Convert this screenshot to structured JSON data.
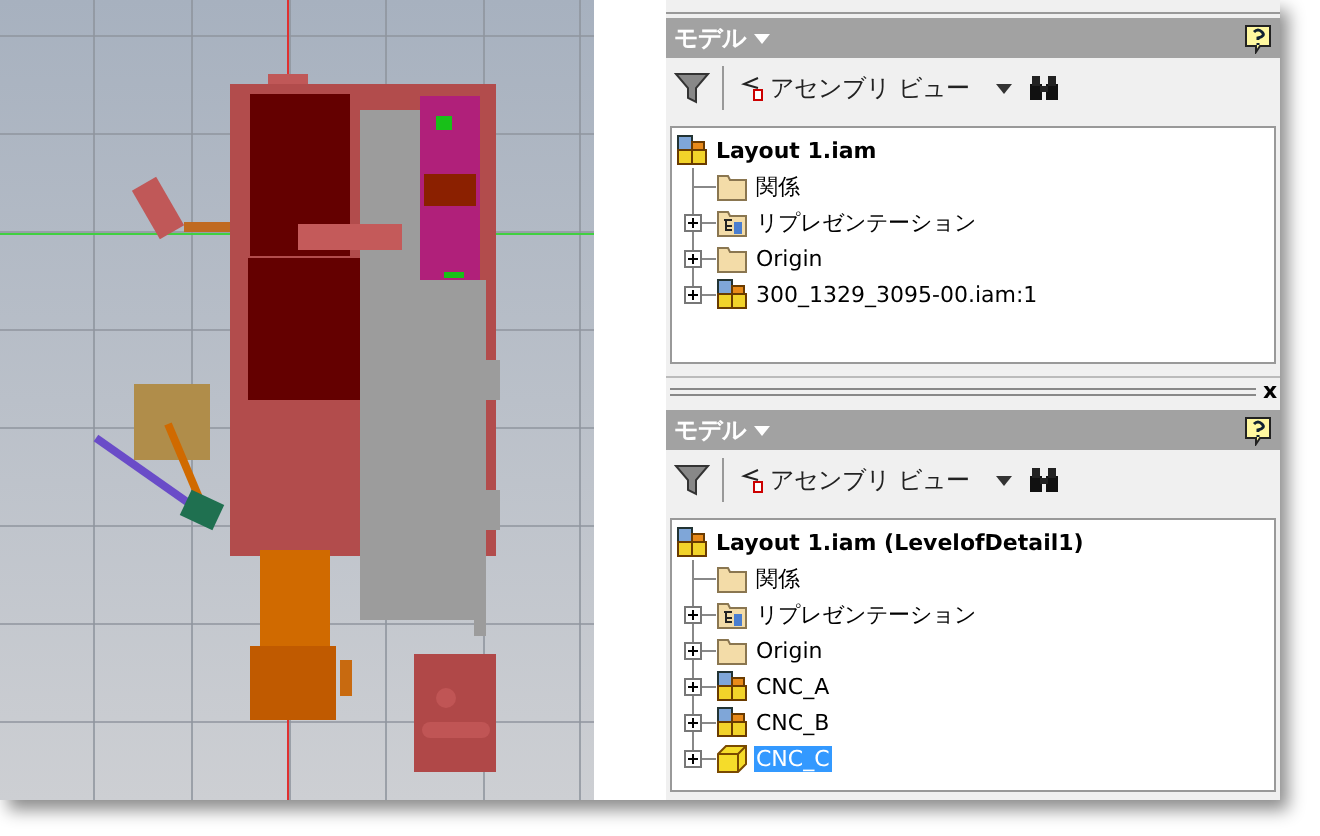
{
  "viewport": {
    "kind": "cad-model"
  },
  "panels": [
    {
      "title": "モデル",
      "closable": false,
      "view_button": "アセンブリ ビュー",
      "tree": {
        "label": "Layout 1.iam",
        "kind": "assembly",
        "children": [
          {
            "label": "関係",
            "kind": "folder",
            "expandable": false,
            "selected": false
          },
          {
            "label": "リプレゼンテーション",
            "kind": "representations",
            "expandable": true,
            "selected": false
          },
          {
            "label": "Origin",
            "kind": "folder",
            "expandable": true,
            "selected": false
          },
          {
            "label": "300_1329_3095-00.iam:1",
            "kind": "assembly",
            "expandable": true,
            "selected": false
          }
        ]
      }
    },
    {
      "title": "モデル",
      "closable": true,
      "close_glyph": "x",
      "view_button": "アセンブリ ビュー",
      "tree": {
        "label": "Layout 1.iam (LevelofDetail1)",
        "kind": "assembly",
        "children": [
          {
            "label": "関係",
            "kind": "folder",
            "expandable": false,
            "selected": false
          },
          {
            "label": "リプレゼンテーション",
            "kind": "representations",
            "expandable": true,
            "selected": false
          },
          {
            "label": "Origin",
            "kind": "folder",
            "expandable": true,
            "selected": false
          },
          {
            "label": "CNC_A",
            "kind": "assembly",
            "expandable": true,
            "selected": false
          },
          {
            "label": "CNC_B",
            "kind": "assembly",
            "expandable": true,
            "selected": false
          },
          {
            "label": "CNC_C",
            "kind": "part",
            "expandable": true,
            "selected": true
          }
        ]
      }
    }
  ]
}
